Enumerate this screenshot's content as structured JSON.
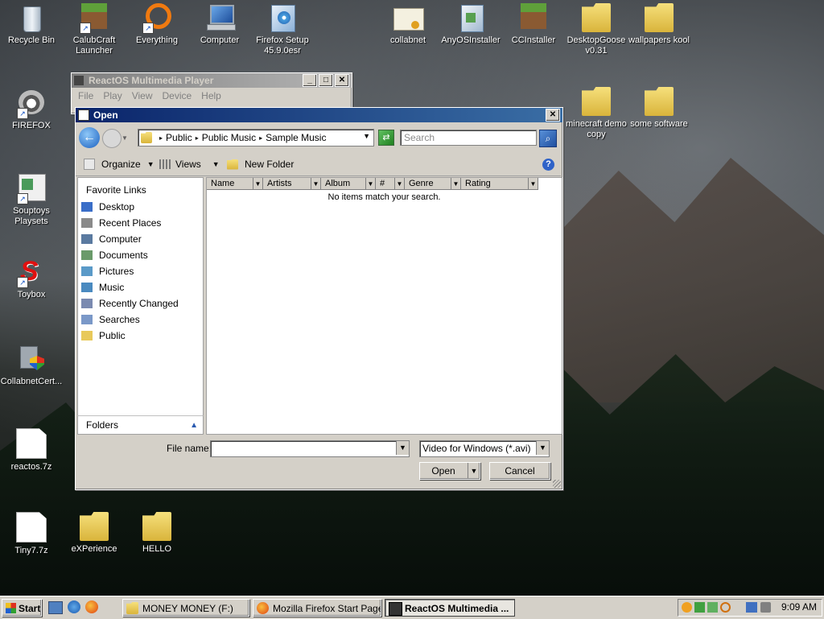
{
  "desktop": {
    "icons": [
      {
        "label": "Recycle Bin"
      },
      {
        "label": "CalubCraft Launcher"
      },
      {
        "label": "Everything"
      },
      {
        "label": "Computer"
      },
      {
        "label": "Firefox Setup 45.9.0esr"
      },
      {
        "label": "collabnet"
      },
      {
        "label": "AnyOSInstaller"
      },
      {
        "label": "CCInstaller"
      },
      {
        "label": "DesktopGoose v0.31"
      },
      {
        "label": "wallpapers kool"
      },
      {
        "label": "FIREFOX"
      },
      {
        "label": "minecraft demo copy"
      },
      {
        "label": "some software"
      },
      {
        "label": "Souptoys Playsets"
      },
      {
        "label": "Toybox"
      },
      {
        "label": "CollabnetCert..."
      },
      {
        "label": "reactos.7z"
      },
      {
        "label": "Tiny7.7z"
      },
      {
        "label": "eXPerience"
      },
      {
        "label": "HELLO"
      }
    ]
  },
  "player": {
    "title": "ReactOS Multimedia Player",
    "menu": [
      "File",
      "Play",
      "View",
      "Device",
      "Help"
    ]
  },
  "dialog": {
    "title": "Open",
    "breadcrumb": [
      "Public",
      "Public Music",
      "Sample Music"
    ],
    "search_placeholder": "Search",
    "toolbar": {
      "organize": "Organize",
      "views": "Views",
      "new_folder": "New Folder"
    },
    "favorite_links_header": "Favorite Links",
    "favorite_links": [
      {
        "label": "Desktop",
        "icon": "desktop-icon"
      },
      {
        "label": "Recent Places",
        "icon": "recent-places-icon"
      },
      {
        "label": "Computer",
        "icon": "computer-icon"
      },
      {
        "label": "Documents",
        "icon": "documents-icon"
      },
      {
        "label": "Pictures",
        "icon": "pictures-icon"
      },
      {
        "label": "Music",
        "icon": "music-icon"
      },
      {
        "label": "Recently Changed",
        "icon": "recently-changed-icon"
      },
      {
        "label": "Searches",
        "icon": "searches-icon"
      },
      {
        "label": "Public",
        "icon": "folder-icon"
      }
    ],
    "folders_label": "Folders",
    "columns": [
      "Name",
      "Artists",
      "Album",
      "#",
      "Genre",
      "Rating"
    ],
    "empty_message": "No items match your search.",
    "file_name_label": "File name:",
    "file_name_value": "",
    "file_type": "Video for Windows (*.avi)",
    "open_label": "Open",
    "cancel_label": "Cancel"
  },
  "taskbar": {
    "start_label": "Start",
    "tasks": [
      {
        "label": "MONEY MONEY (F:)",
        "active": false
      },
      {
        "label": "Mozilla Firefox Start Page ...",
        "active": false
      },
      {
        "label": "ReactOS Multimedia ...",
        "active": true
      }
    ],
    "clock": "9:09 AM"
  },
  "colors": {
    "title_active": "#0a246a",
    "face": "#d4d0c8",
    "folder": "#e8c95a"
  }
}
